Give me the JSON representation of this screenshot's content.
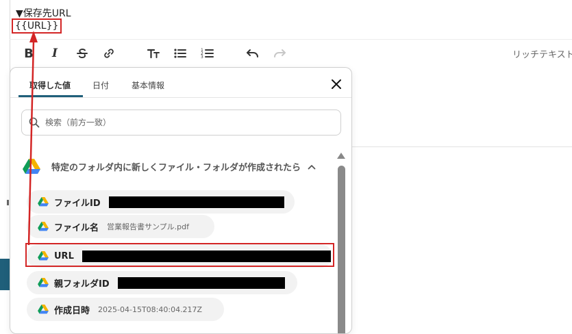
{
  "editor": {
    "heading": "▼保存先URL",
    "token": "{{URL}}",
    "rich_text_label": "リッチテキスト"
  },
  "toolbar": {
    "items": [
      "bold-icon",
      "italic-icon",
      "strikethrough-icon",
      "link-icon",
      "text-size-icon",
      "bullet-list-icon",
      "numbered-list-icon",
      "undo-icon",
      "redo-icon"
    ]
  },
  "popover": {
    "tabs": [
      {
        "label": "取得した値",
        "active": true
      },
      {
        "label": "日付",
        "active": false
      },
      {
        "label": "基本情報",
        "active": false
      }
    ],
    "search": {
      "placeholder": "検索（前方一致）"
    },
    "section": {
      "title": "特定のフォルダ内に新しくファイル・フォルダが作成されたら"
    },
    "fields": [
      {
        "label": "ファイルID",
        "value": "",
        "redacted": true
      },
      {
        "label": "ファイル名",
        "value": "営業報告書サンプル.pdf",
        "redacted": false
      },
      {
        "label": "URL",
        "value": "",
        "redacted": true
      },
      {
        "label": "親フォルダID",
        "value": "",
        "redacted": true
      },
      {
        "label": "作成日時",
        "value": "2025-04-15T08:40:04.217Z",
        "redacted": false
      }
    ]
  },
  "colors": {
    "accent": "#1f5f7a",
    "annotation": "#d32525",
    "drive_green": "#0f9d58",
    "drive_yellow": "#f4b400",
    "drive_blue": "#4285f4"
  }
}
